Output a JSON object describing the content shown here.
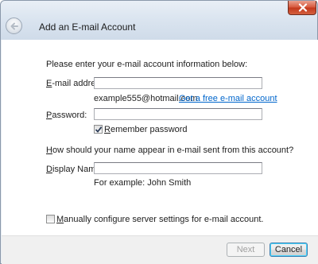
{
  "window": {
    "title": "Add an E-mail Account"
  },
  "form": {
    "intro": "Please enter your e-mail account information below:",
    "email_label_access": "E",
    "email_label_rest": "-mail address:",
    "email_value": "",
    "email_example": "example555@hotmail.com",
    "free_account_link": "Get a free e-mail account",
    "password_label_access": "P",
    "password_label_rest": "assword:",
    "password_value": "",
    "remember_label_access": "R",
    "remember_label_rest": "emember password",
    "remember_checked": true,
    "name_question_access": "H",
    "name_question_rest": "ow should your name appear in e-mail sent from this account?",
    "display_name_label_access": "D",
    "display_name_label_rest": "isplay Name:",
    "display_name_value": "",
    "display_name_example": "For example: John Smith",
    "manual_config_label_access": "M",
    "manual_config_label_rest": "anually configure server settings for e-mail account.",
    "manual_config_checked": false
  },
  "footer": {
    "next_label": "Next",
    "cancel_label": "Cancel"
  },
  "colors": {
    "link": "#0066cc",
    "title_bar": "#dbe5f0",
    "close_button": "#c2381c"
  },
  "icons": {
    "close": "close-icon",
    "back": "back-arrow-icon",
    "check": "checkmark-icon"
  }
}
